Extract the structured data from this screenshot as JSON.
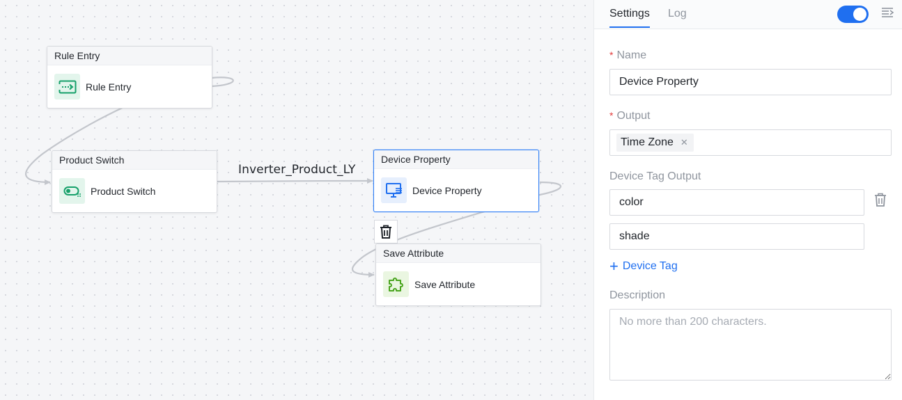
{
  "canvas": {
    "nodes": [
      {
        "id": "rule-entry",
        "header": "Rule Entry",
        "label": "Rule Entry",
        "icon": "entry-icon",
        "color": "#16a06a"
      },
      {
        "id": "product-switch",
        "header": "Product Switch",
        "label": "Product Switch",
        "icon": "switch-icon",
        "color": "#16a06a"
      },
      {
        "id": "device-property",
        "header": "Device Property",
        "label": "Device Property",
        "icon": "monitor-icon",
        "color": "#1f6ff0"
      },
      {
        "id": "save-attribute",
        "header": "Save Attribute",
        "label": "Save Attribute",
        "icon": "puzzle-icon",
        "color": "#4aa51f"
      }
    ],
    "edge_label": "Inverter_Product_LY"
  },
  "panel": {
    "tabs": [
      {
        "label": "Settings",
        "active": true
      },
      {
        "label": "Log",
        "active": false
      }
    ],
    "toggle_on": true,
    "name": {
      "label": "Name",
      "required": true,
      "value": "Device Property"
    },
    "output": {
      "label": "Output",
      "required": true,
      "tags": [
        "Time Zone"
      ]
    },
    "device_tag_output": {
      "label": "Device Tag Output",
      "values": [
        "color",
        "shade"
      ]
    },
    "add_device_tag": "Device Tag",
    "description": {
      "label": "Description",
      "placeholder": "No more than 200 characters."
    },
    "colors": {
      "accent": "#1f6ff0",
      "required": "#e23b3b"
    }
  }
}
